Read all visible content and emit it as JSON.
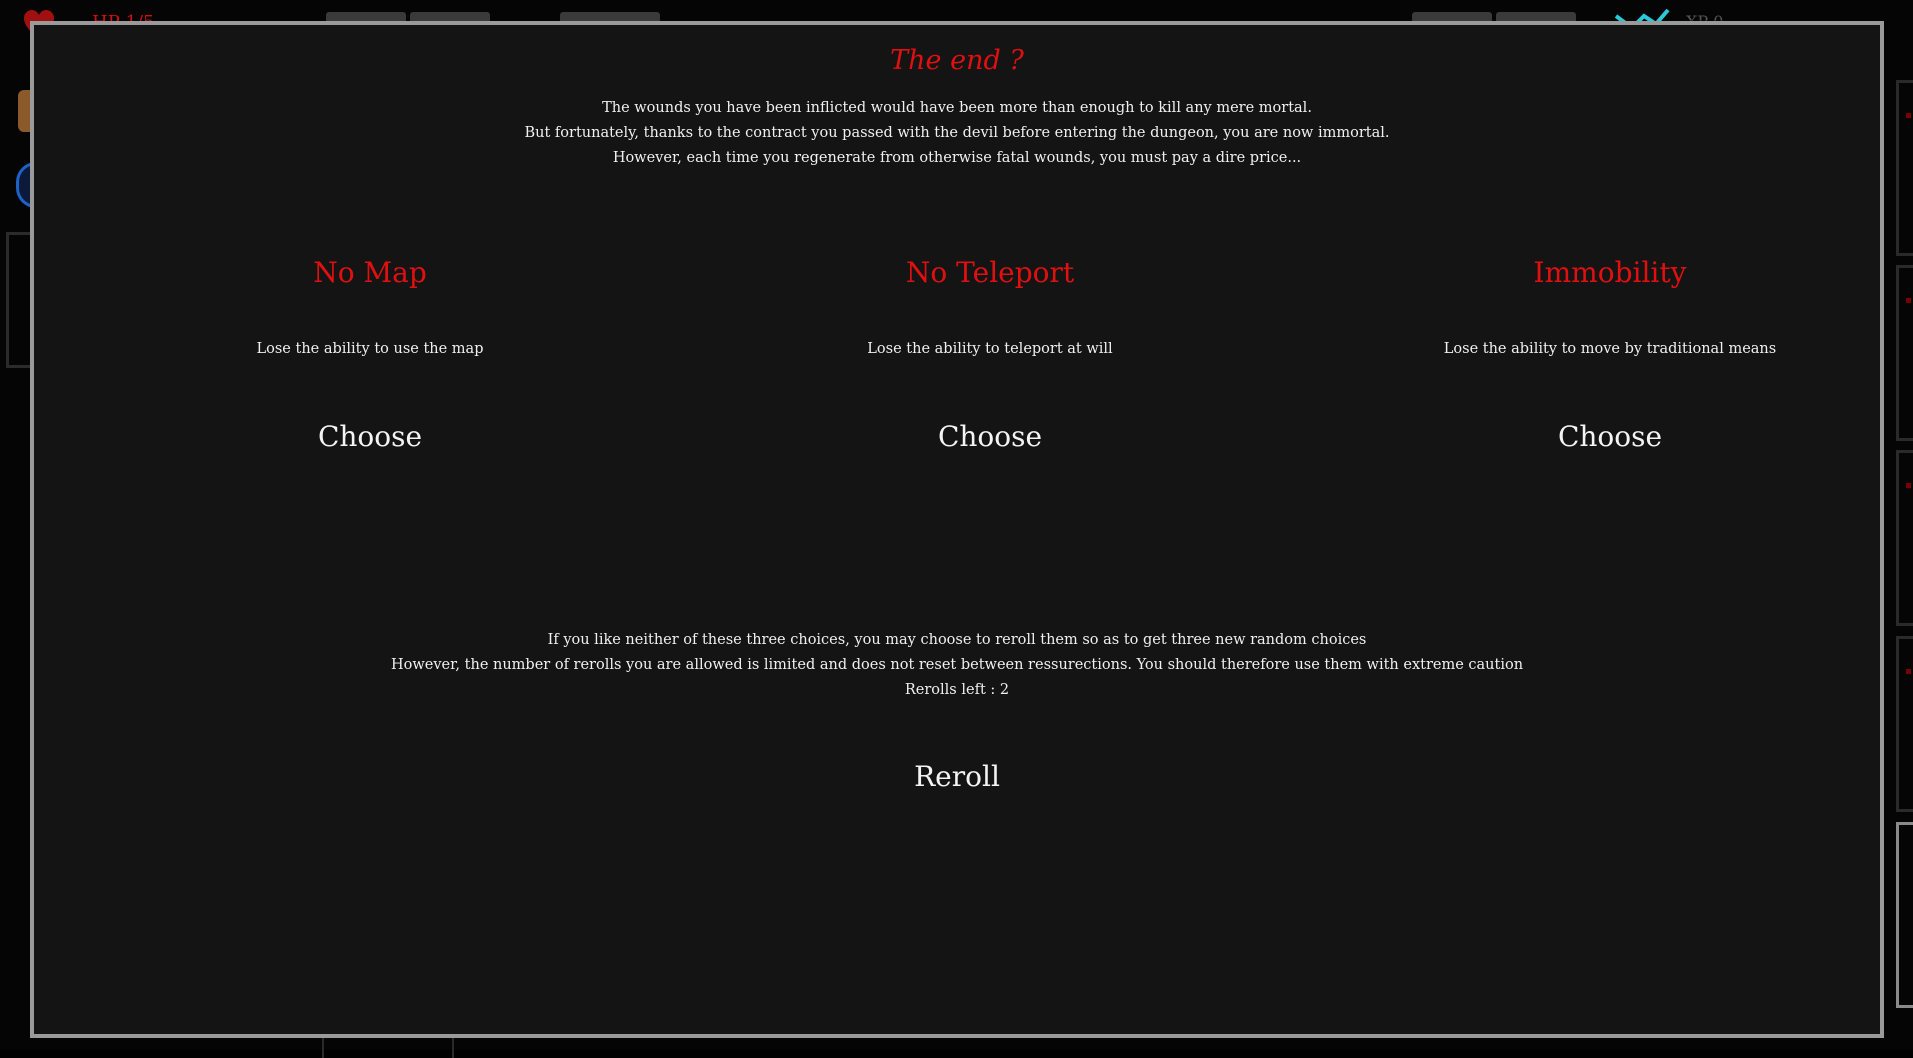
{
  "hud": {
    "hp_label": "HP 1/5",
    "xp_label": "XP 0"
  },
  "modal": {
    "title": "The end ?",
    "intro_lines": [
      "The wounds you have been inflicted would have been more than enough to kill any mere mortal.",
      "But fortunately, thanks to the contract you passed with the devil before entering the dungeon, you are now immortal.",
      "However, each time you regenerate from otherwise fatal wounds, you must pay a dire price..."
    ],
    "options": [
      {
        "title": "No Map",
        "description": "Lose the ability to use the map",
        "button": "Choose"
      },
      {
        "title": "No Teleport",
        "description": "Lose the ability to teleport at will",
        "button": "Choose"
      },
      {
        "title": "Immobility",
        "description": "Lose the ability to move by traditional means",
        "button": "Choose"
      }
    ],
    "reroll_lines": [
      "If you like neither of these three choices, you may choose to reroll them so as to get three new random choices",
      "However, the number of rerolls you are allowed is limited and does not reset between ressurections. You should therefore use them with extreme caution",
      "Rerolls left : 2"
    ],
    "reroll_button": "Reroll"
  },
  "colors": {
    "accent_red": "#e01010",
    "modal_bg": "#141415",
    "modal_border": "#9a9a9a",
    "text": "#f0f0f0"
  }
}
